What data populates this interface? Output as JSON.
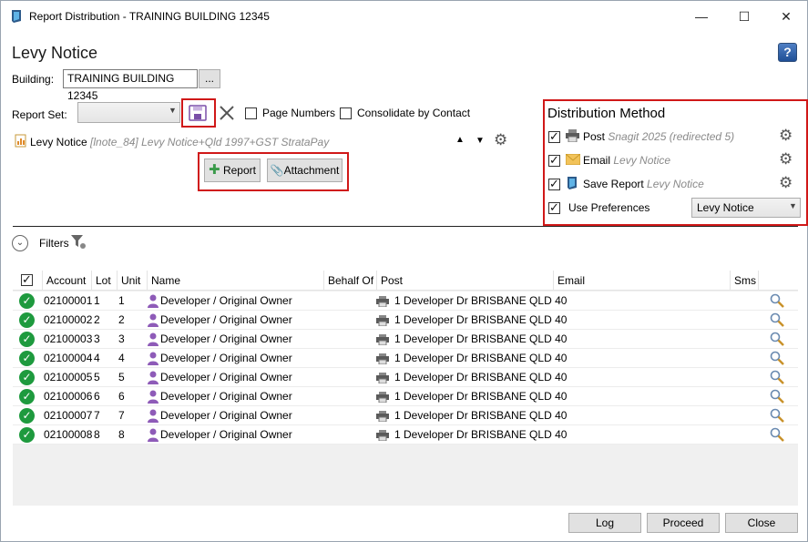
{
  "window": {
    "title": "Report Distribution - TRAINING BUILDING 12345",
    "minimize": "—",
    "maximize": "☐",
    "close": "✕"
  },
  "header": {
    "heading": "Levy Notice",
    "help": "?",
    "building_label": "Building:",
    "building_value": "TRAINING BUILDING 12345",
    "browse": "..."
  },
  "report_set": {
    "label": "Report Set:",
    "value": "",
    "page_numbers": "Page Numbers",
    "consolidate": "Consolidate by Contact"
  },
  "report_item": {
    "name": "Levy Notice",
    "detail": "[lnote_84] Levy Notice+Qld 1997+GST StrataPay"
  },
  "actions": {
    "report": "Report",
    "attachment": "Attachment"
  },
  "distribution": {
    "title": "Distribution Method",
    "methods": [
      {
        "label": "Post",
        "detail": "Snagit 2025 (redirected 5)",
        "checked": true
      },
      {
        "label": "Email",
        "detail": "Levy Notice",
        "checked": true
      },
      {
        "label": "Save Report",
        "detail": "Levy Notice",
        "checked": true
      }
    ],
    "use_preferences": "Use Preferences",
    "preferences_value": "Levy Notice"
  },
  "filters": {
    "label": "Filters"
  },
  "table": {
    "columns": [
      "Account",
      "Lot",
      "Unit",
      "Name",
      "Behalf Of",
      "Post",
      "Email",
      "Sms"
    ],
    "rows": [
      {
        "account": "02100001",
        "lot": "1",
        "unit": "1",
        "name": "Developer / Original Owner",
        "post": "1 Developer Dr BRISBANE QLD 40"
      },
      {
        "account": "02100002",
        "lot": "2",
        "unit": "2",
        "name": "Developer / Original Owner",
        "post": "1 Developer Dr BRISBANE QLD 40"
      },
      {
        "account": "02100003",
        "lot": "3",
        "unit": "3",
        "name": "Developer / Original Owner",
        "post": "1 Developer Dr BRISBANE QLD 40"
      },
      {
        "account": "02100004",
        "lot": "4",
        "unit": "4",
        "name": "Developer / Original Owner",
        "post": "1 Developer Dr BRISBANE QLD 40"
      },
      {
        "account": "02100005",
        "lot": "5",
        "unit": "5",
        "name": "Developer / Original Owner",
        "post": "1 Developer Dr BRISBANE QLD 40"
      },
      {
        "account": "02100006",
        "lot": "6",
        "unit": "6",
        "name": "Developer / Original Owner",
        "post": "1 Developer Dr BRISBANE QLD 40"
      },
      {
        "account": "02100007",
        "lot": "7",
        "unit": "7",
        "name": "Developer / Original Owner",
        "post": "1 Developer Dr BRISBANE QLD 40"
      },
      {
        "account": "02100008",
        "lot": "8",
        "unit": "8",
        "name": "Developer / Original Owner",
        "post": "1 Developer Dr BRISBANE QLD 40"
      }
    ]
  },
  "footer": {
    "log": "Log",
    "proceed": "Proceed",
    "close": "Close"
  },
  "colors": {
    "highlight": "#d01818",
    "success": "#1e9a3e",
    "person": "#8e5bb8"
  }
}
